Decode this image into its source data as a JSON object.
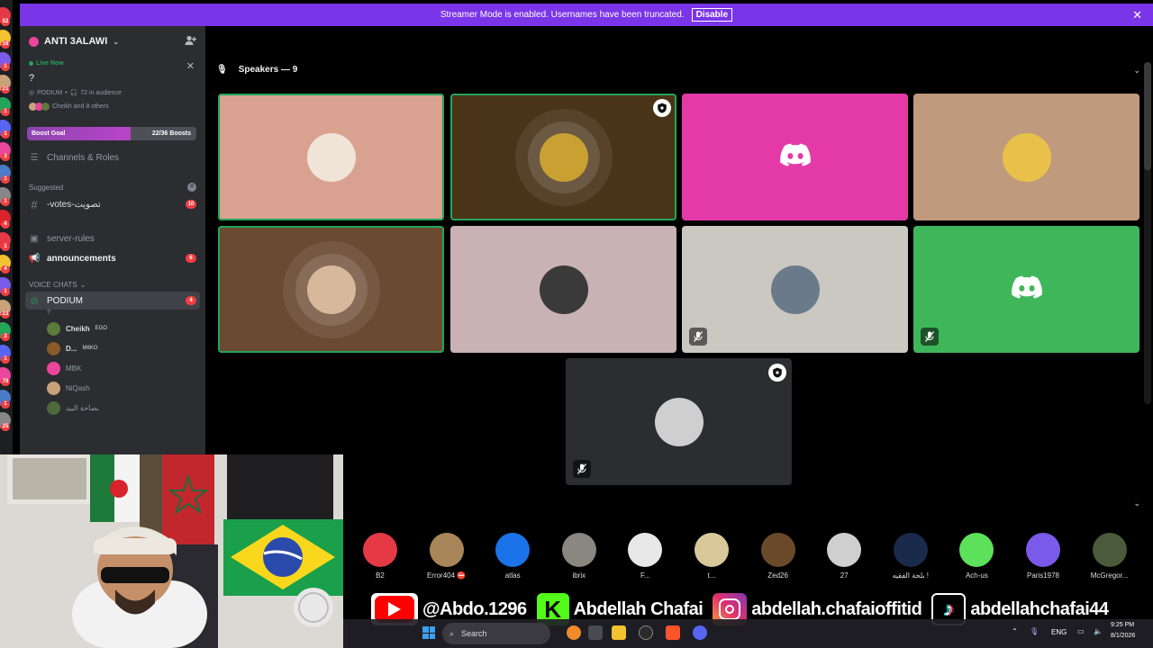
{
  "banner": {
    "text": "Streamer Mode is enabled. Usernames have been truncated.",
    "button": "Disable"
  },
  "server": {
    "name": "ANTI 3ALAWI"
  },
  "live": {
    "label": "Live Now",
    "title": "?",
    "channel": "PODIUM",
    "audience": "72 in audience",
    "speakers_summary": "Cheikh and 8 others"
  },
  "boost": {
    "label": "Boost Goal",
    "count": "22/36 Boosts",
    "progress": 0.61
  },
  "sidebar": {
    "channels_roles": "Channels & Roles",
    "suggested_label": "Suggested",
    "suggested_channel": "-votes-تصويت",
    "suggested_badge": "10",
    "server_rules": "server-rules",
    "announcements": "announcements",
    "announcements_badge": "6",
    "voice_label": "VOICE CHATS",
    "podium": "PODIUM",
    "podium_badge": "4",
    "podium_sub": "?",
    "voice_users": [
      {
        "name": "Cheikh",
        "tag": "EGO",
        "color": "#5c7a3a"
      },
      {
        "name": "D...",
        "tag": "M6KO",
        "color": "#8a5a2a"
      },
      {
        "name": "MBK",
        "tag": "",
        "color": "#eb459e"
      },
      {
        "name": "NiQash",
        "tag": "",
        "color": "#c9a27a"
      },
      {
        "name": "بصاحة البيد",
        "tag": "",
        "color": "#4c6a3a"
      }
    ]
  },
  "rail_badges": [
    "52",
    "16",
    "1",
    "21",
    "1",
    "1",
    "3",
    "1",
    "1",
    "4",
    "1",
    "4",
    "1",
    "23",
    "3",
    "1",
    "79",
    "1",
    "25"
  ],
  "stage": {
    "speakers_label": "Speakers — 9"
  },
  "tiles": [
    {
      "bg": "#d9a290",
      "av": "#f0e4d8",
      "speaking": true,
      "mod": false,
      "muted": false,
      "discord": false,
      "ring": false
    },
    {
      "bg": "#4a3418",
      "av": "#c9a032",
      "speaking": true,
      "mod": true,
      "muted": false,
      "discord": false,
      "ring": true
    },
    {
      "bg": "#e33aa8",
      "av": "",
      "speaking": false,
      "mod": false,
      "muted": false,
      "discord": true,
      "ring": false
    },
    {
      "bg": "#c09a7c",
      "av": "#e8c04a",
      "speaking": false,
      "mod": false,
      "muted": false,
      "discord": false,
      "ring": false
    },
    {
      "bg": "#6b4a32",
      "av": "#d8b89a",
      "speaking": true,
      "mod": false,
      "muted": false,
      "discord": false,
      "ring": true
    },
    {
      "bg": "#c9b2b4",
      "av": "#3a3a3a",
      "speaking": false,
      "mod": false,
      "muted": false,
      "discord": false,
      "ring": false
    },
    {
      "bg": "#cbc7c1",
      "av": "#6a7a8a",
      "speaking": false,
      "mod": false,
      "muted": true,
      "discord": false,
      "ring": false
    },
    {
      "bg": "#3fb65a",
      "av": "",
      "speaking": false,
      "mod": false,
      "muted": true,
      "discord": true,
      "ring": false
    },
    {
      "bg": "#2b2d31",
      "av": "#cfcfcf",
      "speaking": false,
      "mod": true,
      "muted": true,
      "discord": false,
      "ring": false
    }
  ],
  "audience": [
    {
      "name": "B2",
      "color": "#e53946"
    },
    {
      "name": "Error404 ⛔",
      "color": "#a8865a"
    },
    {
      "name": "atlas",
      "color": "#1a73e8"
    },
    {
      "name": "ibrix",
      "color": "#8a8680"
    },
    {
      "name": "F...",
      "color": "#e8e8e8"
    },
    {
      "name": "t...",
      "color": "#d8c89a"
    },
    {
      "name": "Zed26",
      "color": "#6a4a2a"
    },
    {
      "name": "27",
      "color": "#cfcfcf"
    },
    {
      "name": "بلحة الفقيه !",
      "color": "#1a2a4a"
    },
    {
      "name": "Ach-us",
      "color": "#5de05a"
    },
    {
      "name": "Paris1978",
      "color": "#7a5ae8"
    },
    {
      "name": "McGregor...",
      "color": "#4a5a3a"
    }
  ],
  "social": {
    "youtube": "@Abdo.1296",
    "kick": "Abdellah Chafai",
    "instagram": "abdellah.chafaioffitid",
    "tiktok": "abdellahchafai44"
  },
  "taskbar": {
    "search": "Search",
    "lang": "ENG",
    "time": "9:25 PM",
    "date": "8/1/2026"
  }
}
